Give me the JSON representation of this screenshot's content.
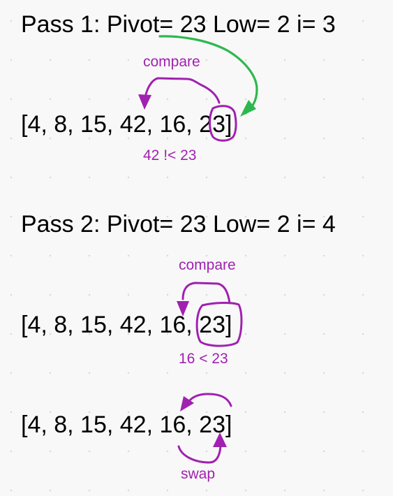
{
  "pass1": {
    "heading": "Pass 1: Pivot= 23 Low= 2 i= 3",
    "array": "[4, 8, 15, 42, 16, 23]",
    "compare_label": "compare",
    "result_label": "42 !< 23"
  },
  "pass2": {
    "heading": "Pass 2: Pivot= 23 Low= 2 i= 4",
    "array": "[4, 8, 15, 42, 16, 23]",
    "compare_label": "compare",
    "result_label": "16 < 23",
    "swap_array": "[4, 8, 15, 42, 16, 23]",
    "swap_label": "swap"
  },
  "colors": {
    "annotation": "#a021b0",
    "pointer_arrow": "#2db84d",
    "text": "#000000",
    "background": "#f8f8f8"
  }
}
